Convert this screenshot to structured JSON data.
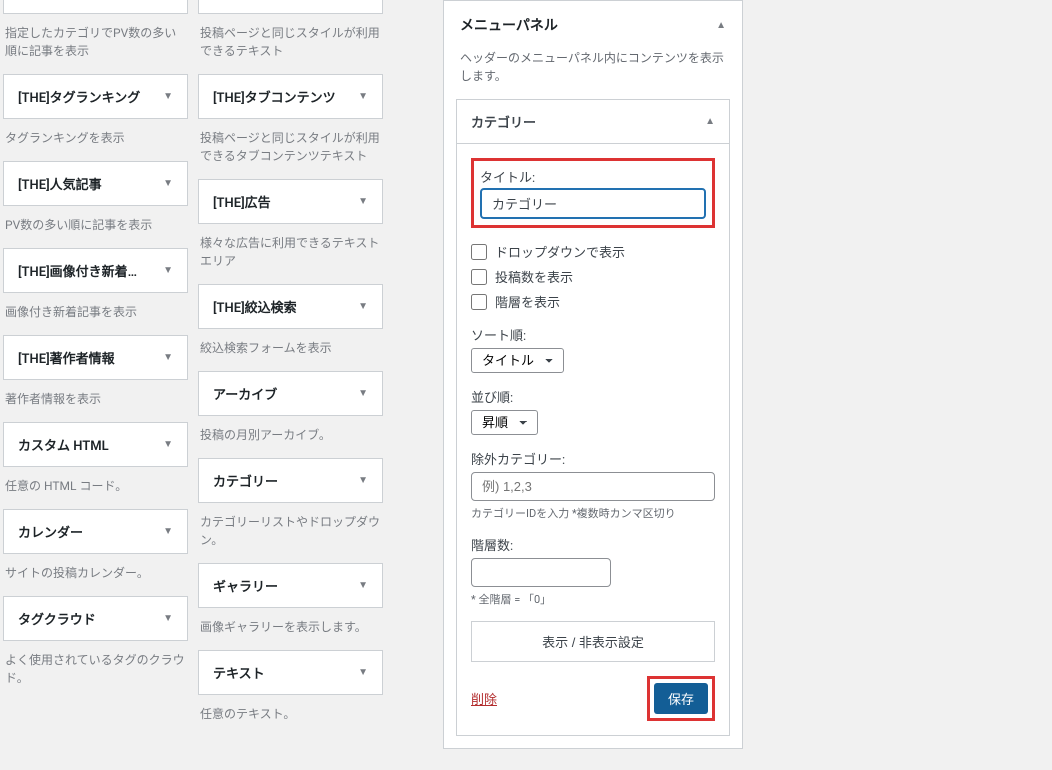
{
  "widgets_left": [
    {
      "title": "",
      "desc": "指定したカテゴリでPV数の多い順に記事を表示"
    },
    {
      "title": "[THE]タグランキング",
      "desc": "タグランキングを表示"
    },
    {
      "title": "[THE]人気記事",
      "desc": "PV数の多い順に記事を表示"
    },
    {
      "title": "[THE]画像付き新着…",
      "desc": "画像付き新着記事を表示"
    },
    {
      "title": "[THE]著作者情報",
      "desc": "著作者情報を表示"
    },
    {
      "title": "カスタム HTML",
      "desc": "任意の HTML コード。"
    },
    {
      "title": "カレンダー",
      "desc": "サイトの投稿カレンダー。"
    },
    {
      "title": "タグクラウド",
      "desc": "よく使用されているタグのクラウド。"
    }
  ],
  "widgets_right": [
    {
      "title": "",
      "desc": "投稿ページと同じスタイルが利用できるテキスト"
    },
    {
      "title": "[THE]タブコンテンツ",
      "desc": "投稿ページと同じスタイルが利用できるタブコンテンツテキスト"
    },
    {
      "title": "[THE]広告",
      "desc": "様々な広告に利用できるテキストエリア"
    },
    {
      "title": "[THE]絞込検索",
      "desc": "絞込検索フォームを表示"
    },
    {
      "title": "アーカイブ",
      "desc": "投稿の月別アーカイブ。"
    },
    {
      "title": "カテゴリー",
      "desc": "カテゴリーリストやドロップダウン。"
    },
    {
      "title": "ギャラリー",
      "desc": "画像ギャラリーを表示します。"
    },
    {
      "title": "テキスト",
      "desc": "任意のテキスト。"
    }
  ],
  "panel": {
    "title": "メニューパネル",
    "desc": "ヘッダーのメニューパネル内にコンテンツを表示します。"
  },
  "config": {
    "header": "カテゴリー",
    "title_label": "タイトル:",
    "title_value": "カテゴリー",
    "checkbox_dropdown": "ドロップダウンで表示",
    "checkbox_count": "投稿数を表示",
    "checkbox_hierarchy": "階層を表示",
    "sort_label": "ソート順:",
    "sort_value": "タイトル",
    "order_label": "並び順:",
    "order_value": "昇順",
    "exclude_label": "除外カテゴリー:",
    "exclude_placeholder": "例) 1,2,3",
    "exclude_hint": "カテゴリーIDを入力 *複数時カンマ区切り",
    "depth_label": "階層数:",
    "depth_hint": "* 全階層 = 「0」",
    "toggle_label": "表示 / 非表示設定",
    "delete_label": "削除",
    "save_label": "保存"
  }
}
